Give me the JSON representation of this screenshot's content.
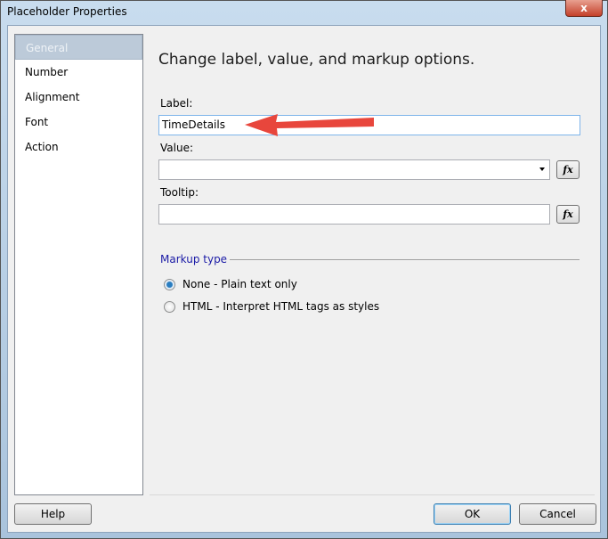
{
  "window": {
    "title": "Placeholder Properties",
    "close": "x"
  },
  "sidebar": {
    "items": [
      {
        "label": "General",
        "selected": true
      },
      {
        "label": "Number"
      },
      {
        "label": "Alignment"
      },
      {
        "label": "Font"
      },
      {
        "label": "Action"
      }
    ]
  },
  "main": {
    "heading": "Change label, value, and markup options.",
    "label_field": {
      "label": "Label:",
      "value": "TimeDetails"
    },
    "value_field": {
      "label": "Value:",
      "value": ""
    },
    "tooltip_field": {
      "label": "Tooltip:",
      "value": ""
    },
    "fx": "fx",
    "markup": {
      "title": "Markup type",
      "options": [
        {
          "label": "None - Plain text only",
          "checked": true
        },
        {
          "label": "HTML - Interpret HTML tags as styles",
          "checked": false
        }
      ]
    }
  },
  "buttons": {
    "help": "Help",
    "ok": "OK",
    "cancel": "Cancel"
  },
  "colors": {
    "annotation_arrow": "#e8463c"
  }
}
